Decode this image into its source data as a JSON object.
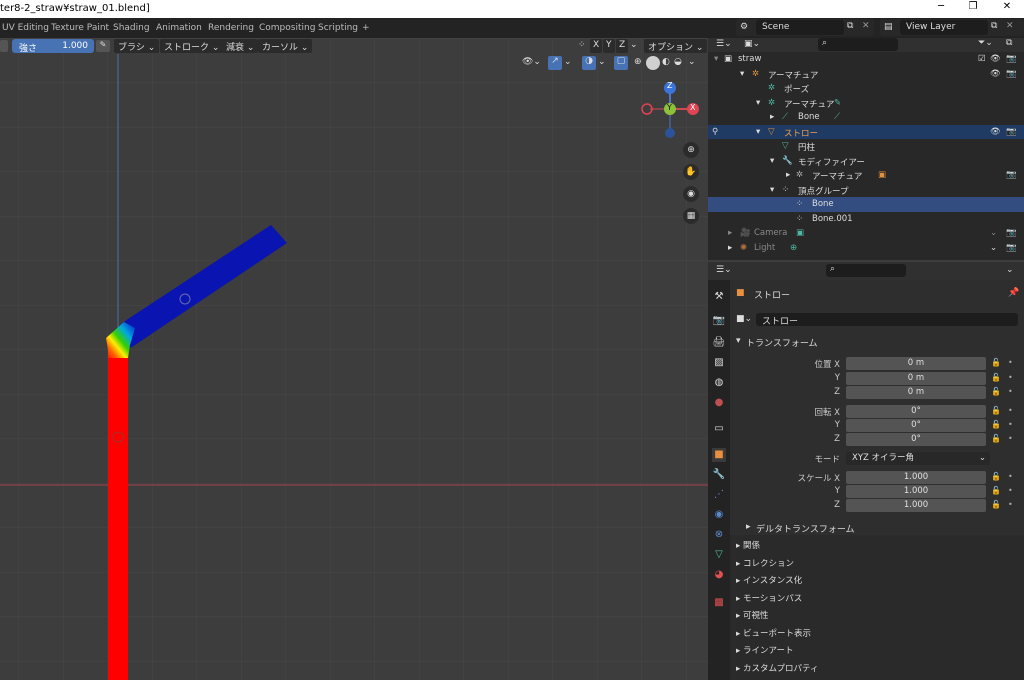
{
  "window": {
    "title": "ter8-2_straw¥straw_01.blend]",
    "minimize": "─",
    "maximize": "❐",
    "close": "✕"
  },
  "workspace_tabs": [
    "UV Editing",
    "Texture Paint",
    "Shading",
    "Animation",
    "Rendering",
    "Compositing",
    "Scripting",
    "+"
  ],
  "scene": {
    "name": "Scene",
    "view_layer": "View Layer"
  },
  "viewport": {
    "strength_label": "強さ",
    "strength_value": "1.000",
    "menus": [
      "ブラシ",
      "ストローク",
      "減衰",
      "カーソル"
    ],
    "axes": [
      "X",
      "Y",
      "Z"
    ],
    "options_label": "オプション",
    "gizmo": {
      "z": "Z",
      "y": "Y",
      "x": "X"
    }
  },
  "outliner": {
    "rows": [
      {
        "label": "straw",
        "indent": 0
      },
      {
        "label": "アーマチュア",
        "indent": 1
      },
      {
        "label": "ポーズ",
        "indent": 2
      },
      {
        "label": "アーマチュア",
        "indent": 2
      },
      {
        "label": "Bone",
        "indent": 3
      },
      {
        "label": "ストロー",
        "indent": 1
      },
      {
        "label": "円柱",
        "indent": 2
      },
      {
        "label": "モディファイアー",
        "indent": 2
      },
      {
        "label": "アーマチュア",
        "indent": 3
      },
      {
        "label": "頂点グループ",
        "indent": 2
      },
      {
        "label": "Bone",
        "indent": 3
      },
      {
        "label": "Bone.001",
        "indent": 3
      },
      {
        "label": "Camera",
        "indent": 1
      },
      {
        "label": "Light",
        "indent": 1
      }
    ]
  },
  "properties": {
    "object_name": "ストロー",
    "data_name": "ストロー",
    "transform_header": "トランスフォーム",
    "location_label": "位置 X",
    "location": [
      "0 m",
      "0 m",
      "0 m"
    ],
    "rotation_label": "回転 X",
    "rotation": [
      "0°",
      "0°",
      "0°"
    ],
    "axis_y": "Y",
    "axis_z": "Z",
    "mode_label": "モード",
    "mode_value": "XYZ オイラー角",
    "scale_label": "スケール X",
    "scale": [
      "1.000",
      "1.000",
      "1.000"
    ],
    "delta_transform": "デルタトランスフォーム",
    "sections": [
      "関係",
      "コレクション",
      "インスタンス化",
      "モーションパス",
      "可視性",
      "ビューポート表示",
      "ラインアート",
      "カスタムプロパティ"
    ]
  }
}
